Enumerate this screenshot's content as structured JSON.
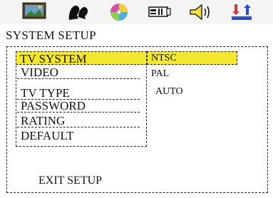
{
  "header": {
    "icons": [
      "system-setup-icon",
      "language-icon",
      "audio-disc-icon",
      "video-icon",
      "speaker-icon",
      "preferences-icon"
    ]
  },
  "title": "SYSTEM SETUP",
  "menu": {
    "items": [
      "TV SYSTEM",
      "VIDEO",
      "TV TYPE",
      "PASSWORD",
      "RATING",
      "DEFAULT"
    ],
    "selected_index": 0
  },
  "options": {
    "items": [
      "NTSC",
      "PAL",
      "AUTO"
    ],
    "selected_index": 0
  },
  "exit_label": "EXIT SETUP",
  "colors": {
    "highlight": "#f3e82e"
  }
}
